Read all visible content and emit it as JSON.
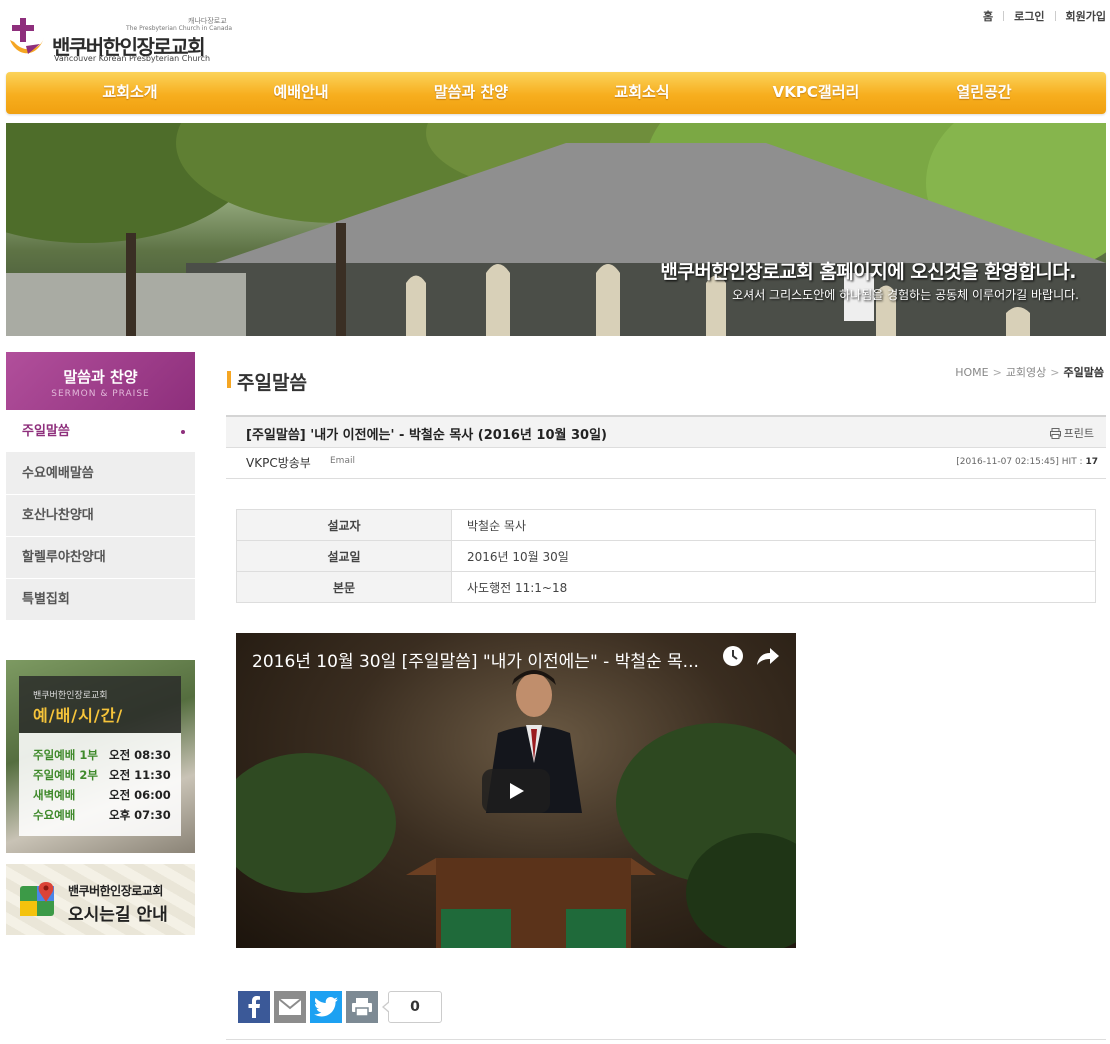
{
  "header": {
    "logo_small_ko": "캐나다장로교",
    "logo_small_en": "The Presbyterian Church in Canada",
    "logo_main_ko": "밴쿠버한인장로교회",
    "logo_main_en": "Vancouver Korean Presbyterian Church",
    "util_links": [
      "홈",
      "로그인",
      "회원가입"
    ]
  },
  "nav": [
    "교회소개",
    "예배안내",
    "말씀과 찬양",
    "교회소식",
    "VKPC갤러리",
    "열린공간"
  ],
  "banner": {
    "title": "밴쿠버한인장로교회 홈페이지에 오신것을 환영합니다.",
    "subtitle": "오셔서 그리스도안에 하나됨을 경험하는 공동체 이루어가길 바랍니다."
  },
  "sidebar": {
    "heading_ko": "말씀과 찬양",
    "heading_en": "SERMON & PRAISE",
    "items": [
      "주일말씀",
      "수요예배말씀",
      "호산나찬양대",
      "할렐루야찬양대",
      "특별집회"
    ],
    "active_index": 0,
    "service_box": {
      "church": "밴쿠버한인장로교회",
      "title": "예/배/시/간/",
      "rows": [
        {
          "name": "주일예배 1부",
          "time": "오전 08:30"
        },
        {
          "name": "주일예배 2부",
          "time": "오전 11:30"
        },
        {
          "name": "새벽예배",
          "time": "오전 06:00"
        },
        {
          "name": "수요예배",
          "time": "오후 07:30"
        }
      ]
    },
    "map_box": {
      "line1": "밴쿠버한인장로교회",
      "line2": "오시는길 안내"
    }
  },
  "page": {
    "title": "주일말씀",
    "breadcrumb": [
      "HOME",
      "교회영상",
      "주일말씀"
    ]
  },
  "post": {
    "title": "[주일말씀] '내가 이전에는' - 박철순 목사 (2016년 10월 30일)",
    "print_label": "프린트",
    "writer": "VKPC방송부",
    "email_label": "Email",
    "date": "[2016-11-07 02:15:45]",
    "hit_label": "HIT :",
    "hit": "17",
    "table": [
      {
        "key": "설교자",
        "value": "박철순 목사"
      },
      {
        "key": "설교일",
        "value": "2016년 10월 30일"
      },
      {
        "key": "본문",
        "value": "사도행전 11:1~18"
      }
    ],
    "video_title": "2016년 10월 30일 [주일말씀] \"내가 이전에는\" - 박철순 목...",
    "share_count": "0"
  },
  "colors": {
    "nav_orange": "#f7ae1e",
    "sidebar_purple": "#8e2f7c",
    "service_green": "#3f8a2b",
    "facebook": "#3b5998",
    "twitter": "#1da1f2"
  }
}
